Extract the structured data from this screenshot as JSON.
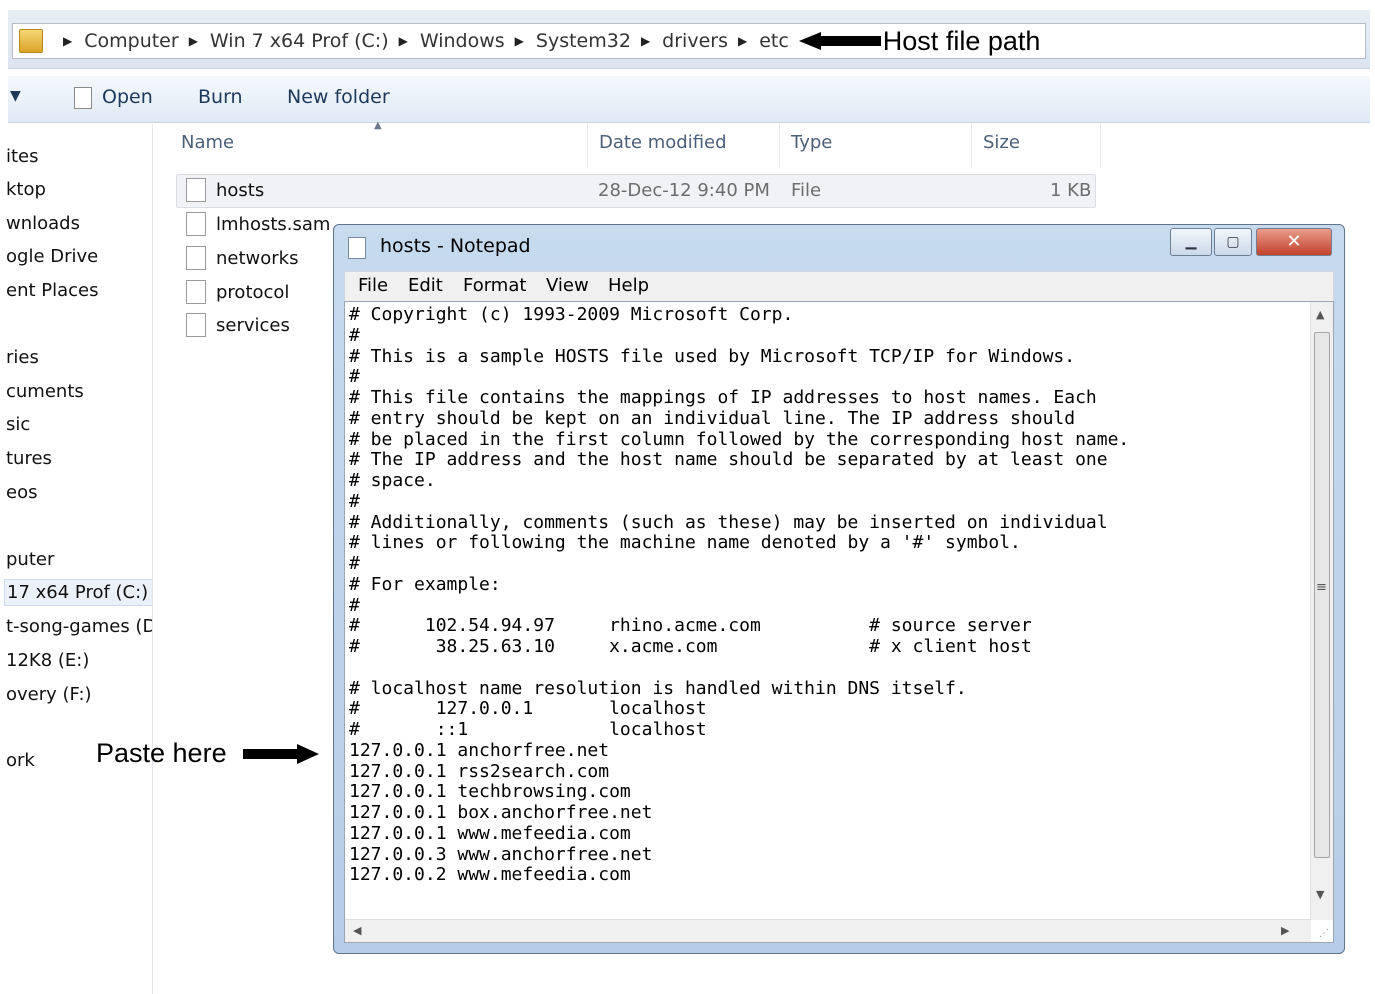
{
  "address_bar": {
    "crumbs": [
      "Computer",
      "Win 7 x64 Prof (C:)",
      "Windows",
      "System32",
      "drivers",
      "etc"
    ],
    "annotation": "Host file path"
  },
  "toolbar": {
    "open_label": "Open",
    "burn_label": "Burn",
    "new_folder_label": "New folder"
  },
  "sidebar": {
    "items": [
      "ites",
      "ktop",
      "wnloads",
      "ogle Drive",
      "ent Places",
      "ries",
      "cuments",
      "sic",
      "tures",
      "eos",
      "puter",
      "17 x64 Prof (C:)",
      "t-song-games (D",
      "12K8 (E:)",
      "overy (F:)",
      "ork"
    ],
    "selected_index": 11
  },
  "file_list": {
    "columns": [
      "Name",
      "Date modified",
      "Type",
      "Size"
    ],
    "files": [
      {
        "name": "hosts",
        "date": "28-Dec-12 9:40 PM",
        "type": "File",
        "size": "1 KB"
      },
      {
        "name": "lmhosts.sam",
        "date": "",
        "type": "",
        "size": ""
      },
      {
        "name": "networks",
        "date": "",
        "type": "",
        "size": ""
      },
      {
        "name": "protocol",
        "date": "",
        "type": "",
        "size": ""
      },
      {
        "name": "services",
        "date": "",
        "type": "",
        "size": ""
      }
    ]
  },
  "notepad": {
    "title": "hosts - Notepad",
    "menu": [
      "File",
      "Edit",
      "Format",
      "View",
      "Help"
    ],
    "content": "# Copyright (c) 1993-2009 Microsoft Corp.\n#\n# This is a sample HOSTS file used by Microsoft TCP/IP for Windows.\n#\n# This file contains the mappings of IP addresses to host names. Each\n# entry should be kept on an individual line. The IP address should\n# be placed in the first column followed by the corresponding host name.\n# The IP address and the host name should be separated by at least one\n# space.\n#\n# Additionally, comments (such as these) may be inserted on individual\n# lines or following the machine name denoted by a '#' symbol.\n#\n# For example:\n#\n#      102.54.94.97     rhino.acme.com          # source server\n#       38.25.63.10     x.acme.com              # x client host\n\n# localhost name resolution is handled within DNS itself.\n#\t127.0.0.1       localhost\n#\t::1             localhost\n127.0.0.1 anchorfree.net\n127.0.0.1 rss2search.com\n127.0.0.1 techbrowsing.com\n127.0.0.1 box.anchorfree.net\n127.0.0.1 www.mefeedia.com\n127.0.0.3 www.anchorfree.net\n127.0.0.2 www.mefeedia.com"
  },
  "paste_annotation": "Paste here"
}
